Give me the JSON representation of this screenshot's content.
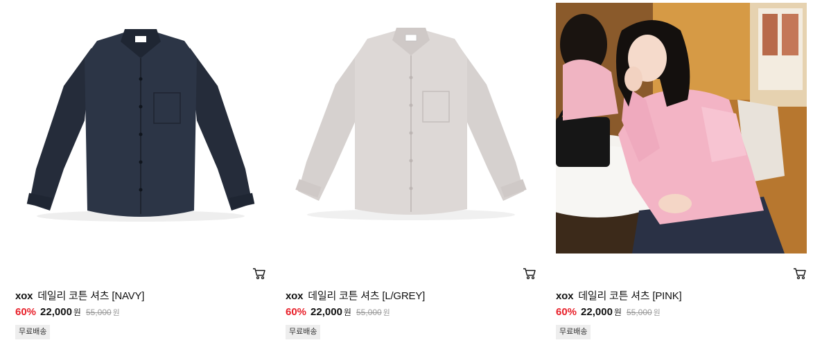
{
  "products": [
    {
      "image_alt": "데일리 코튼 셔츠 NAVY",
      "shirt_color": "#2a3242",
      "brand": "xox",
      "name": "데일리 코튼 셔츠 [NAVY]",
      "discount": "60%",
      "sale_price": "22,000",
      "unit": "원",
      "original_price": "55,000",
      "original_unit": "원",
      "badge": "무료배송",
      "cart_icon": "cart-icon"
    },
    {
      "image_alt": "데일리 코튼 셔츠 L/GREY",
      "shirt_color": "#dcd7d5",
      "brand": "xox",
      "name": "데일리 코튼 셔츠 [L/GREY]",
      "discount": "60%",
      "sale_price": "22,000",
      "unit": "원",
      "original_price": "55,000",
      "original_unit": "원",
      "badge": "무료배송",
      "cart_icon": "cart-icon"
    },
    {
      "image_alt": "데일리 코튼 셔츠 PINK",
      "shirt_color": "#f2b3c4",
      "brand": "xox",
      "name": "데일리 코튼 셔츠 [PINK]",
      "discount": "60%",
      "sale_price": "22,000",
      "unit": "원",
      "original_price": "55,000",
      "original_unit": "원",
      "badge": "무료배송",
      "cart_icon": "cart-icon"
    }
  ],
  "colors": {
    "discount": "#e8202a",
    "badge_bg": "#eeeeee",
    "strike": "#999999"
  }
}
